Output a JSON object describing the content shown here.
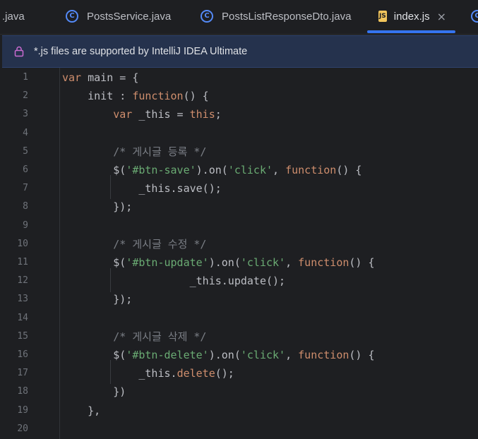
{
  "tabs": [
    {
      "label": ".java",
      "icon": "none",
      "active": false
    },
    {
      "label": "PostsService.java",
      "icon": "class-icon",
      "active": false
    },
    {
      "label": "PostsListResponseDto.java",
      "icon": "class-icon",
      "active": false
    },
    {
      "label": "index.js",
      "icon": "js-icon",
      "active": true
    }
  ],
  "close_glyph": "×",
  "js_badge": "JS",
  "class_badge": "C",
  "banner": {
    "text": "*.js files are supported by IntelliJ IDEA Ultimate",
    "icon": "lock-icon"
  },
  "colors": {
    "keyword": "#cf8e6d",
    "string": "#6aab73",
    "comment": "#7a7e85",
    "accent": "#3574f0",
    "banner_bg": "#25324d"
  },
  "lines": [
    {
      "n": "1",
      "code": "var main = {"
    },
    {
      "n": "2",
      "code": "    init : function() {"
    },
    {
      "n": "3",
      "code": "        var _this = this;"
    },
    {
      "n": "4",
      "code": ""
    },
    {
      "n": "5",
      "code": "        /* 게시글 등록 */"
    },
    {
      "n": "6",
      "code": "        $('#btn-save').on('click', function() {"
    },
    {
      "n": "7",
      "code": "            _this.save();"
    },
    {
      "n": "8",
      "code": "        });"
    },
    {
      "n": "9",
      "code": ""
    },
    {
      "n": "10",
      "code": "        /* 게시글 수정 */"
    },
    {
      "n": "11",
      "code": "        $('#btn-update').on('click', function() {"
    },
    {
      "n": "12",
      "code": "                    _this.update();"
    },
    {
      "n": "13",
      "code": "        });"
    },
    {
      "n": "14",
      "code": ""
    },
    {
      "n": "15",
      "code": "        /* 게시글 삭제 */"
    },
    {
      "n": "16",
      "code": "        $('#btn-delete').on('click', function() {"
    },
    {
      "n": "17",
      "code": "            _this.delete();"
    },
    {
      "n": "18",
      "code": "        })"
    },
    {
      "n": "19",
      "code": "    },"
    },
    {
      "n": "20",
      "code": ""
    }
  ]
}
